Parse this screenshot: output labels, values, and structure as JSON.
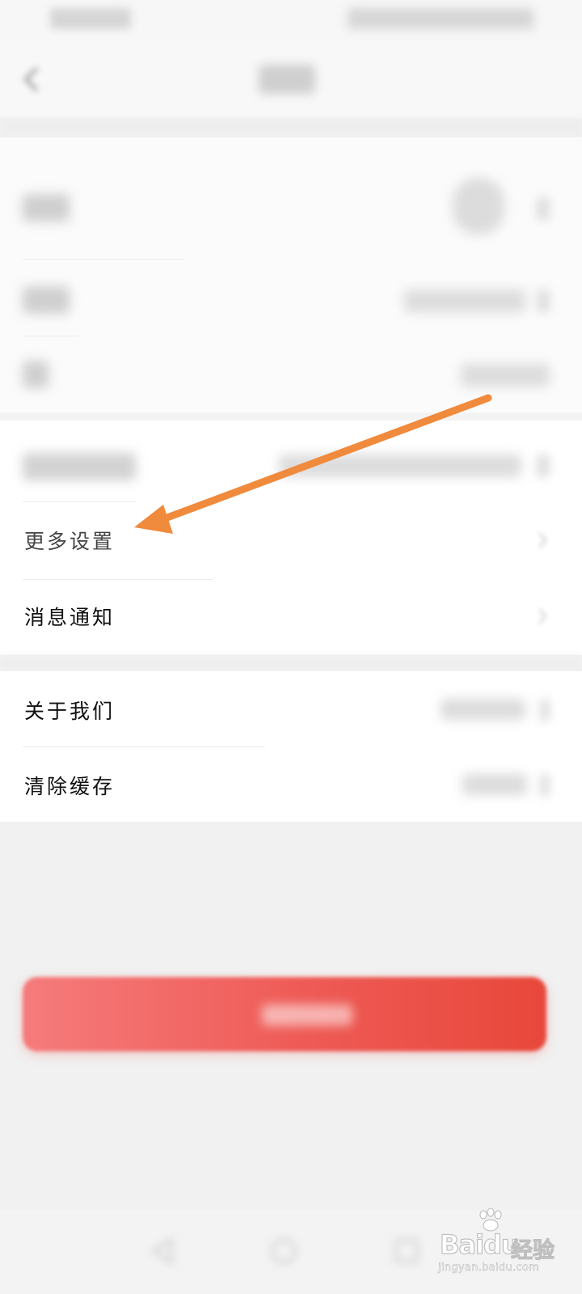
{
  "settings_list": {
    "items": [
      {
        "label": "更多设置"
      },
      {
        "label": "消息通知"
      },
      {
        "label": "关于我们"
      },
      {
        "label": "清除缓存"
      }
    ]
  },
  "watermark": {
    "brand": "Bai",
    "brand_suffix": "du",
    "product": "经验",
    "domain": "jingyan.baidu.com"
  },
  "colors": {
    "arrow": "#f08a3c",
    "logout_gradient_start": "#f57b7b",
    "logout_gradient_end": "#e8473a",
    "text": "#111111"
  },
  "icons": {
    "annotation": "arrow-pointer-icon",
    "back": "chevron-left-icon",
    "row": "chevron-right-icon"
  }
}
